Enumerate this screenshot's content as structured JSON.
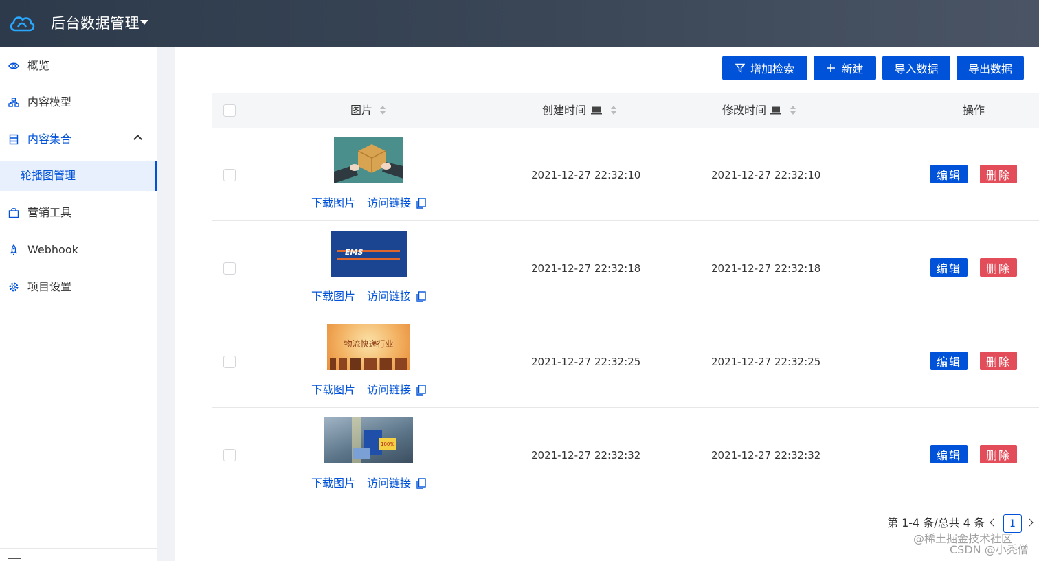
{
  "header": {
    "title": "后台数据管理"
  },
  "sidebar": {
    "items": [
      {
        "label": "概览"
      },
      {
        "label": "内容模型"
      },
      {
        "label": "内容集合"
      },
      {
        "label": "轮播图管理"
      },
      {
        "label": "营销工具"
      },
      {
        "label": "Webhook"
      },
      {
        "label": "项目设置"
      }
    ]
  },
  "toolbar": {
    "add_filter": "增加检索",
    "create": "新建",
    "import": "导入数据",
    "export": "导出数据"
  },
  "table": {
    "columns": {
      "image": "图片",
      "created": "创建时间",
      "modified": "修改时间",
      "actions": "操作"
    },
    "download_label": "下载图片",
    "visit_label": "访问链接",
    "edit_label": "编辑",
    "delete_label": "删除",
    "rows": [
      {
        "created": "2021-12-27 22:32:10",
        "modified": "2021-12-27 22:32:10",
        "thumb_text": ""
      },
      {
        "created": "2021-12-27 22:32:18",
        "modified": "2021-12-27 22:32:18",
        "thumb_text": "EMS"
      },
      {
        "created": "2021-12-27 22:32:25",
        "modified": "2021-12-27 22:32:25",
        "thumb_text": "物流快递行业"
      },
      {
        "created": "2021-12-27 22:32:32",
        "modified": "2021-12-27 22:32:32",
        "thumb_text": "100%"
      }
    ]
  },
  "pagination": {
    "summary": "第 1-4 条/总共 4 条",
    "current": "1"
  },
  "watermark": {
    "line1": "@稀土掘金技术社区",
    "line2": "CSDN @小秃僧"
  },
  "colors": {
    "primary": "#0052d9",
    "danger": "#e34d59",
    "header_bg": "#2c3a4b"
  }
}
